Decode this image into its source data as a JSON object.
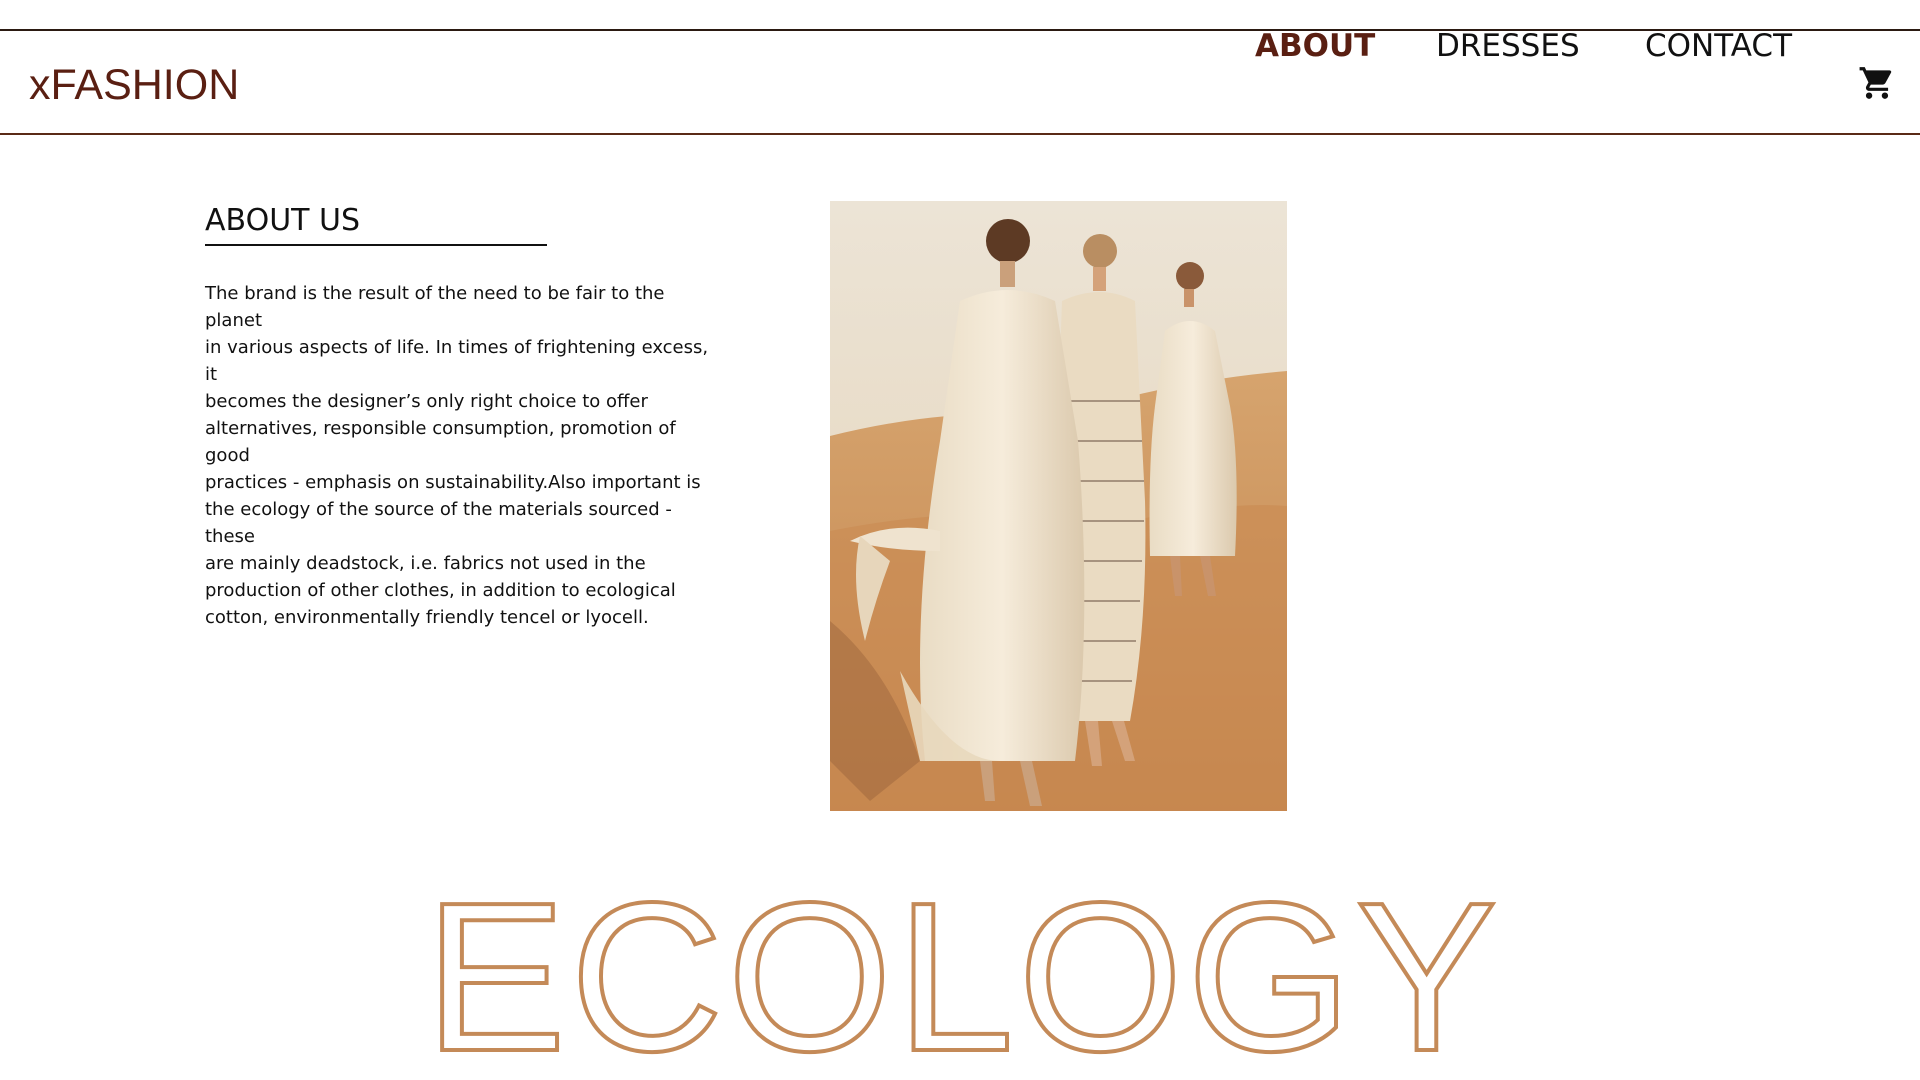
{
  "brand": {
    "logo": "xFASHION",
    "accent_color": "#5a1f12",
    "outline_color": "#c48a58"
  },
  "nav": {
    "items": [
      {
        "label": "ABOUT",
        "active": true
      },
      {
        "label": "DRESSES",
        "active": false
      },
      {
        "label": "CONTACT",
        "active": false
      }
    ],
    "cart_icon": "shopping-cart-icon"
  },
  "about": {
    "title": "ABOUT US",
    "body": "The brand is the result of the need to be fair to the planet\nin various aspects of life. In times of frightening excess, it\nbecomes the designer’s only right choice to offer\nalternatives, responsible consumption, promotion of good\npractices - emphasis on sustainability.Also important is\nthe ecology of the source of the materials sourced - these\nare mainly deadstock, i.e. fabrics not used in the\nproduction of other clothes, in addition to ecological\ncotton, environmentally friendly tencel or lyocell."
  },
  "hero_word": "ECOLOGY"
}
